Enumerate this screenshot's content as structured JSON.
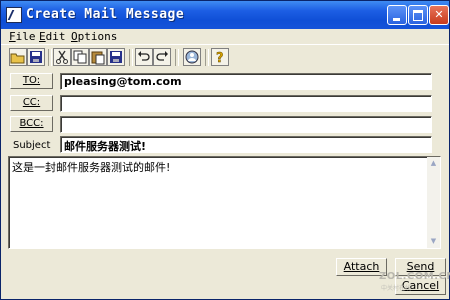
{
  "window": {
    "title": "Create Mail Message"
  },
  "menu": [
    {
      "accel": "F",
      "rest": "ile"
    },
    {
      "accel": "E",
      "rest": "dit"
    },
    {
      "accel": "O",
      "rest": "ptions"
    }
  ],
  "toolbar": {
    "icons": [
      "open-folder-icon",
      "save-disk-icon",
      "cut-scissors-icon",
      "copy-icon",
      "paste-icon",
      "save-as-icon",
      "undo-icon",
      "redo-icon",
      "address-book-icon",
      "help-icon"
    ]
  },
  "header": {
    "to_label": "TO:",
    "cc_label": "CC:",
    "bcc_label": "BCC:",
    "subject_label": "Subject",
    "to_value": "pleasing@tom.com",
    "cc_value": "",
    "bcc_value": "",
    "subject_value": "邮件服务器测试!"
  },
  "body": {
    "text": "这是一封邮件服务器测试的邮件!"
  },
  "actions": {
    "attach_label": "Attach",
    "send_label": "Send",
    "cancel_label": "Cancel"
  },
  "watermark": {
    "text": "ZOL.COM.CN",
    "sub": "中关村在线"
  },
  "colors": {
    "titlebar": "#1c5ee4",
    "window_bg": "#ece9d8",
    "close_button": "#c83b1c"
  }
}
